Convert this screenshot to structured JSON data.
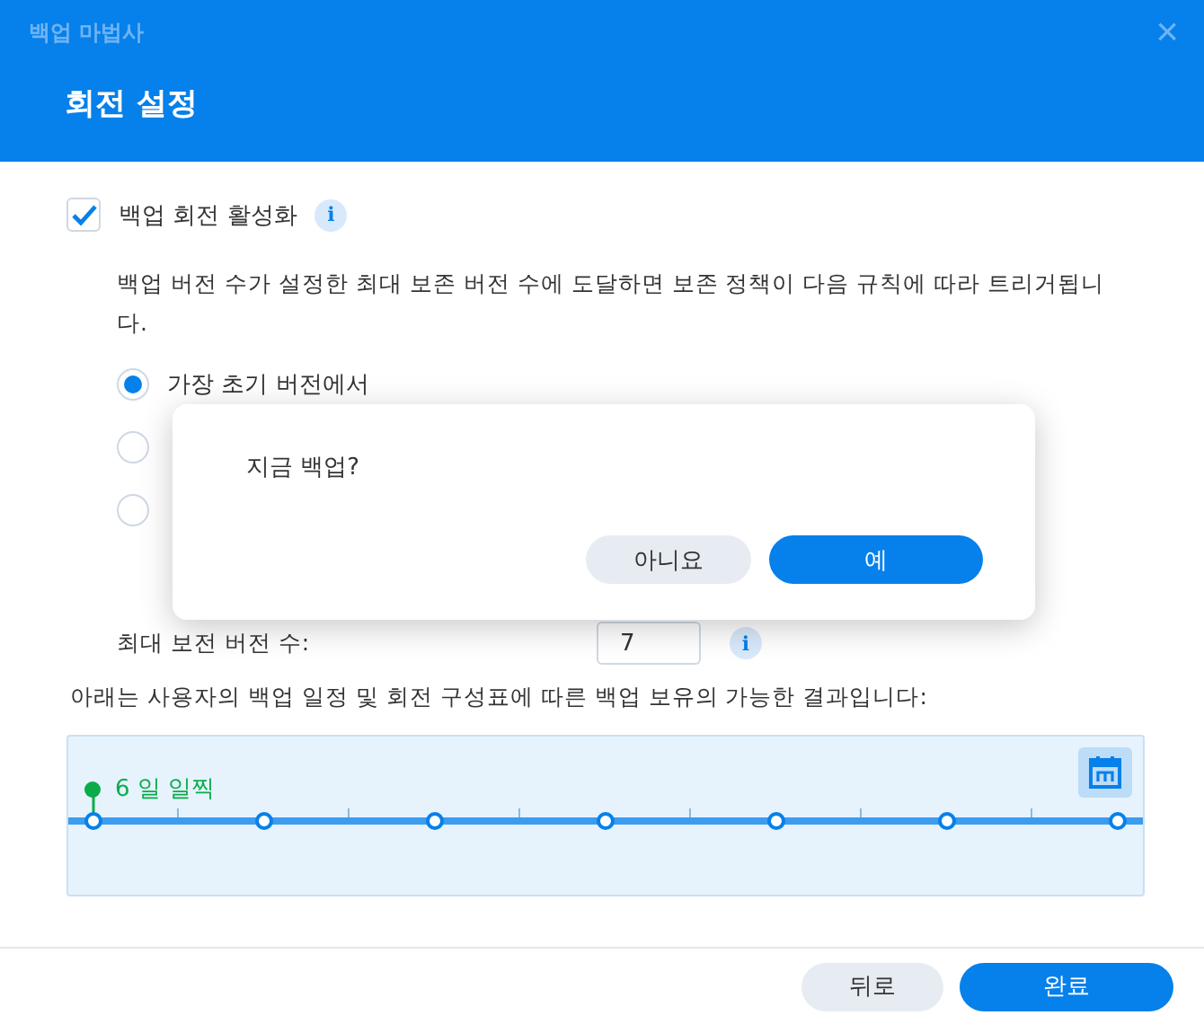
{
  "window": {
    "title": "백업 마법사",
    "close": "×"
  },
  "header": {
    "title": "회전 설정"
  },
  "rotation": {
    "label": "백업 회전 활성화",
    "checked": true,
    "info": "i"
  },
  "description": "백업 버전 수가 설정한 최대 보존 버전 수에 도달하면 보존 정책이 다음 규칙에 따라 트리거됩니다.",
  "options": [
    {
      "label": "가장 초기 버전에서",
      "selected": true
    },
    {
      "selected": false
    },
    {
      "selected": false
    }
  ],
  "max_versions": {
    "label": "최대 보전 버전 수:",
    "value": "7",
    "info": "i"
  },
  "result_text": "아래는 사용자의 백업 일정 및 회전 구성표에 따른 백업 보유의 가능한 결과입니다:",
  "timeline": {
    "marker_label": "6 일 일찍"
  },
  "dialog": {
    "message": "지금 백업?",
    "buttons": [
      {
        "label": "아니요",
        "kind": "secondary"
      },
      {
        "label": "예",
        "kind": "primary"
      }
    ]
  },
  "footer": {
    "buttons": [
      {
        "label": "뒤로",
        "kind": "secondary"
      },
      {
        "label": "완료",
        "kind": "primary"
      }
    ]
  }
}
